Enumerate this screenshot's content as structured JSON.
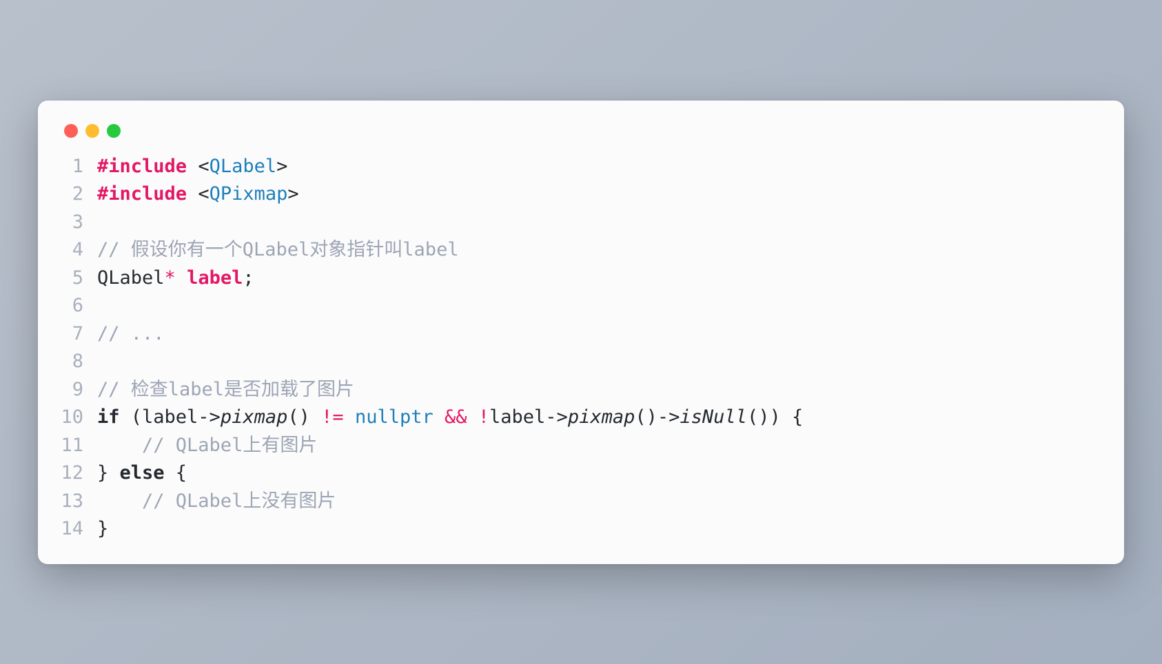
{
  "code": {
    "lines": [
      {
        "n": "1",
        "tokens": [
          {
            "t": "#",
            "c": "tok-dir"
          },
          {
            "t": "include ",
            "c": "tok-dir"
          },
          {
            "t": "<",
            "c": "tok-angle"
          },
          {
            "t": "QLabel",
            "c": "tok-hdr"
          },
          {
            "t": ">",
            "c": "tok-angle"
          }
        ]
      },
      {
        "n": "2",
        "tokens": [
          {
            "t": "#",
            "c": "tok-dir"
          },
          {
            "t": "include ",
            "c": "tok-dir"
          },
          {
            "t": "<",
            "c": "tok-angle"
          },
          {
            "t": "QPixmap",
            "c": "tok-hdr"
          },
          {
            "t": ">",
            "c": "tok-angle"
          }
        ]
      },
      {
        "n": "3",
        "tokens": []
      },
      {
        "n": "4",
        "tokens": [
          {
            "t": "// 假设你有一个QLabel对象指针叫label",
            "c": "tok-comment"
          }
        ]
      },
      {
        "n": "5",
        "tokens": [
          {
            "t": "QLabel",
            "c": "tok-type"
          },
          {
            "t": "* ",
            "c": "tok-op"
          },
          {
            "t": "label",
            "c": "tok-var"
          },
          {
            "t": ";",
            "c": "tok-type"
          }
        ]
      },
      {
        "n": "6",
        "tokens": []
      },
      {
        "n": "7",
        "tokens": [
          {
            "t": "// ...",
            "c": "tok-comment"
          }
        ]
      },
      {
        "n": "8",
        "tokens": []
      },
      {
        "n": "9",
        "tokens": [
          {
            "t": "// 检查label是否加载了图片",
            "c": "tok-comment"
          }
        ]
      },
      {
        "n": "10",
        "tokens": [
          {
            "t": "if",
            "c": "tok-kw"
          },
          {
            "t": " (label->",
            "c": "tok-type"
          },
          {
            "t": "pixmap",
            "c": "tok-call"
          },
          {
            "t": "() ",
            "c": "tok-type"
          },
          {
            "t": "!= ",
            "c": "tok-op"
          },
          {
            "t": "nullptr",
            "c": "tok-null"
          },
          {
            "t": " && !",
            "c": "tok-op"
          },
          {
            "t": "label->",
            "c": "tok-type"
          },
          {
            "t": "pixmap",
            "c": "tok-call"
          },
          {
            "t": "()->",
            "c": "tok-type"
          },
          {
            "t": "isNull",
            "c": "tok-call"
          },
          {
            "t": "()) {",
            "c": "tok-type"
          }
        ]
      },
      {
        "n": "11",
        "tokens": [
          {
            "t": "    // QLabel上有图片",
            "c": "tok-comment"
          }
        ]
      },
      {
        "n": "12",
        "tokens": [
          {
            "t": "} ",
            "c": "tok-type"
          },
          {
            "t": "else",
            "c": "tok-kw"
          },
          {
            "t": " {",
            "c": "tok-type"
          }
        ]
      },
      {
        "n": "13",
        "tokens": [
          {
            "t": "    // QLabel上没有图片",
            "c": "tok-comment"
          }
        ]
      },
      {
        "n": "14",
        "tokens": [
          {
            "t": "}",
            "c": "tok-type"
          }
        ]
      }
    ]
  }
}
